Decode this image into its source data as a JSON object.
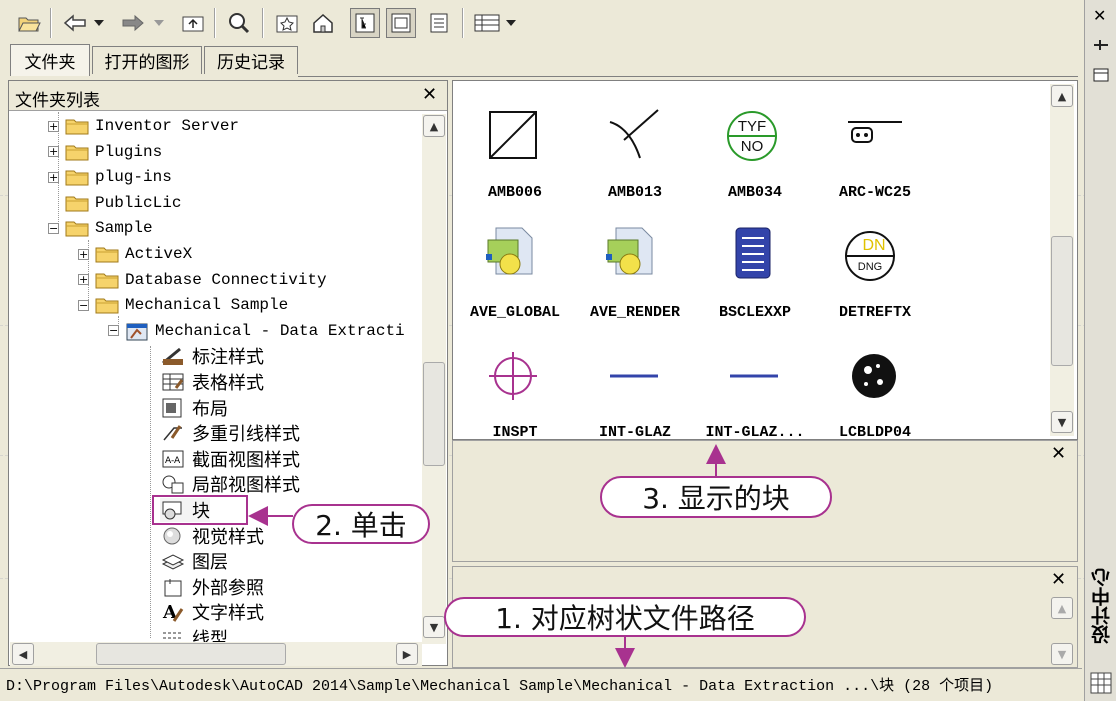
{
  "tabs": [
    {
      "label": "文件夹",
      "active": true
    },
    {
      "label": "打开的图形",
      "active": false
    },
    {
      "label": "历史记录",
      "active": false
    }
  ],
  "folder_list": {
    "title": "文件夹列表",
    "items": [
      {
        "label": "Inventor Server",
        "expander": "+"
      },
      {
        "label": "Plugins",
        "expander": "+"
      },
      {
        "label": "plug-ins",
        "expander": "+"
      },
      {
        "label": "PublicLic",
        "expander": ""
      },
      {
        "label": "Sample",
        "expander": "-"
      },
      {
        "label": "ActiveX",
        "expander": "+"
      },
      {
        "label": "Database Connectivity",
        "expander": "+"
      },
      {
        "label": "Mechanical Sample",
        "expander": "-"
      },
      {
        "label": "Mechanical - Data Extracti",
        "expander": "-"
      },
      {
        "label": "标注样式",
        "icon": "dimension-style-icon"
      },
      {
        "label": "表格样式",
        "icon": "table-style-icon"
      },
      {
        "label": "布局",
        "icon": "layout-icon"
      },
      {
        "label": "多重引线样式",
        "icon": "multileader-style-icon"
      },
      {
        "label": "截面视图样式",
        "icon": "section-view-icon"
      },
      {
        "label": "局部视图样式",
        "icon": "detail-view-icon"
      },
      {
        "label": "块",
        "icon": "block-icon",
        "selected": true
      },
      {
        "label": "视觉样式",
        "icon": "visual-style-icon"
      },
      {
        "label": "图层",
        "icon": "layer-icon"
      },
      {
        "label": "外部参照",
        "icon": "xref-icon"
      },
      {
        "label": "文字样式",
        "icon": "text-style-icon"
      },
      {
        "label": "线型",
        "icon": "linetype-icon"
      }
    ]
  },
  "blocks": [
    {
      "name": "AMB006"
    },
    {
      "name": "AMB013"
    },
    {
      "name": "AMB034"
    },
    {
      "name": "ARC-WC25"
    },
    {
      "name": "AVE_GLOBAL"
    },
    {
      "name": "AVE_RENDER"
    },
    {
      "name": "BSCLEXXP"
    },
    {
      "name": "DETREFTX"
    },
    {
      "name": "INSPT"
    },
    {
      "name": "INT-GLAZ"
    },
    {
      "name": "INT-GLAZ..."
    },
    {
      "name": "LCBLDP04"
    }
  ],
  "block_labels": {
    "amb034_top": "TYF",
    "amb034_bottom": "NO",
    "detref_top": "DN",
    "detref_bottom": "DNG"
  },
  "status_path": "D:\\Program Files\\Autodesk\\AutoCAD 2014\\Sample\\Mechanical Sample\\Mechanical - Data Extraction ...\\块 (28 个项目)",
  "callouts": {
    "one": "1. 对应树状文件路径",
    "two": "2. 单击",
    "three": "3. 显示的块"
  },
  "right_strip_label": "设计中心",
  "colors": {
    "callout_border": "#a8328f",
    "accent_block": "#3333aa"
  }
}
